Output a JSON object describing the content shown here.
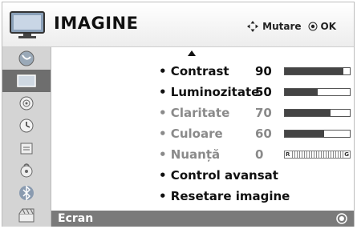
{
  "header": {
    "title": "IMAGINE",
    "move_hint": "Mutare",
    "ok_hint": "OK"
  },
  "sidebar": {
    "items": [
      {
        "icon": "satellite-dish-icon"
      },
      {
        "icon": "tv-screen-icon",
        "active": true
      },
      {
        "icon": "speaker-icon"
      },
      {
        "icon": "clock-icon"
      },
      {
        "icon": "lock-icon"
      },
      {
        "icon": "options-icon"
      },
      {
        "icon": "bluetooth-icon"
      },
      {
        "icon": "usb-media-icon"
      }
    ]
  },
  "menu": {
    "items": [
      {
        "label": "• Contrast",
        "value": "90",
        "level": 0.9,
        "enabled": true
      },
      {
        "label": "• Luminozitate",
        "value": "50",
        "level": 0.5,
        "enabled": true
      },
      {
        "label": "• Claritate",
        "value": "70",
        "level": 0.7,
        "enabled": false
      },
      {
        "label": "• Culoare",
        "value": "60",
        "level": 0.6,
        "enabled": false
      },
      {
        "label": "• Nuanță",
        "value": "0",
        "tint_left": "R",
        "tint_right": "G",
        "enabled": false
      },
      {
        "label": "• Control avansat",
        "enabled": true
      },
      {
        "label": "• Resetare imagine",
        "enabled": true
      }
    ],
    "selected": {
      "label": "Ecran"
    }
  }
}
